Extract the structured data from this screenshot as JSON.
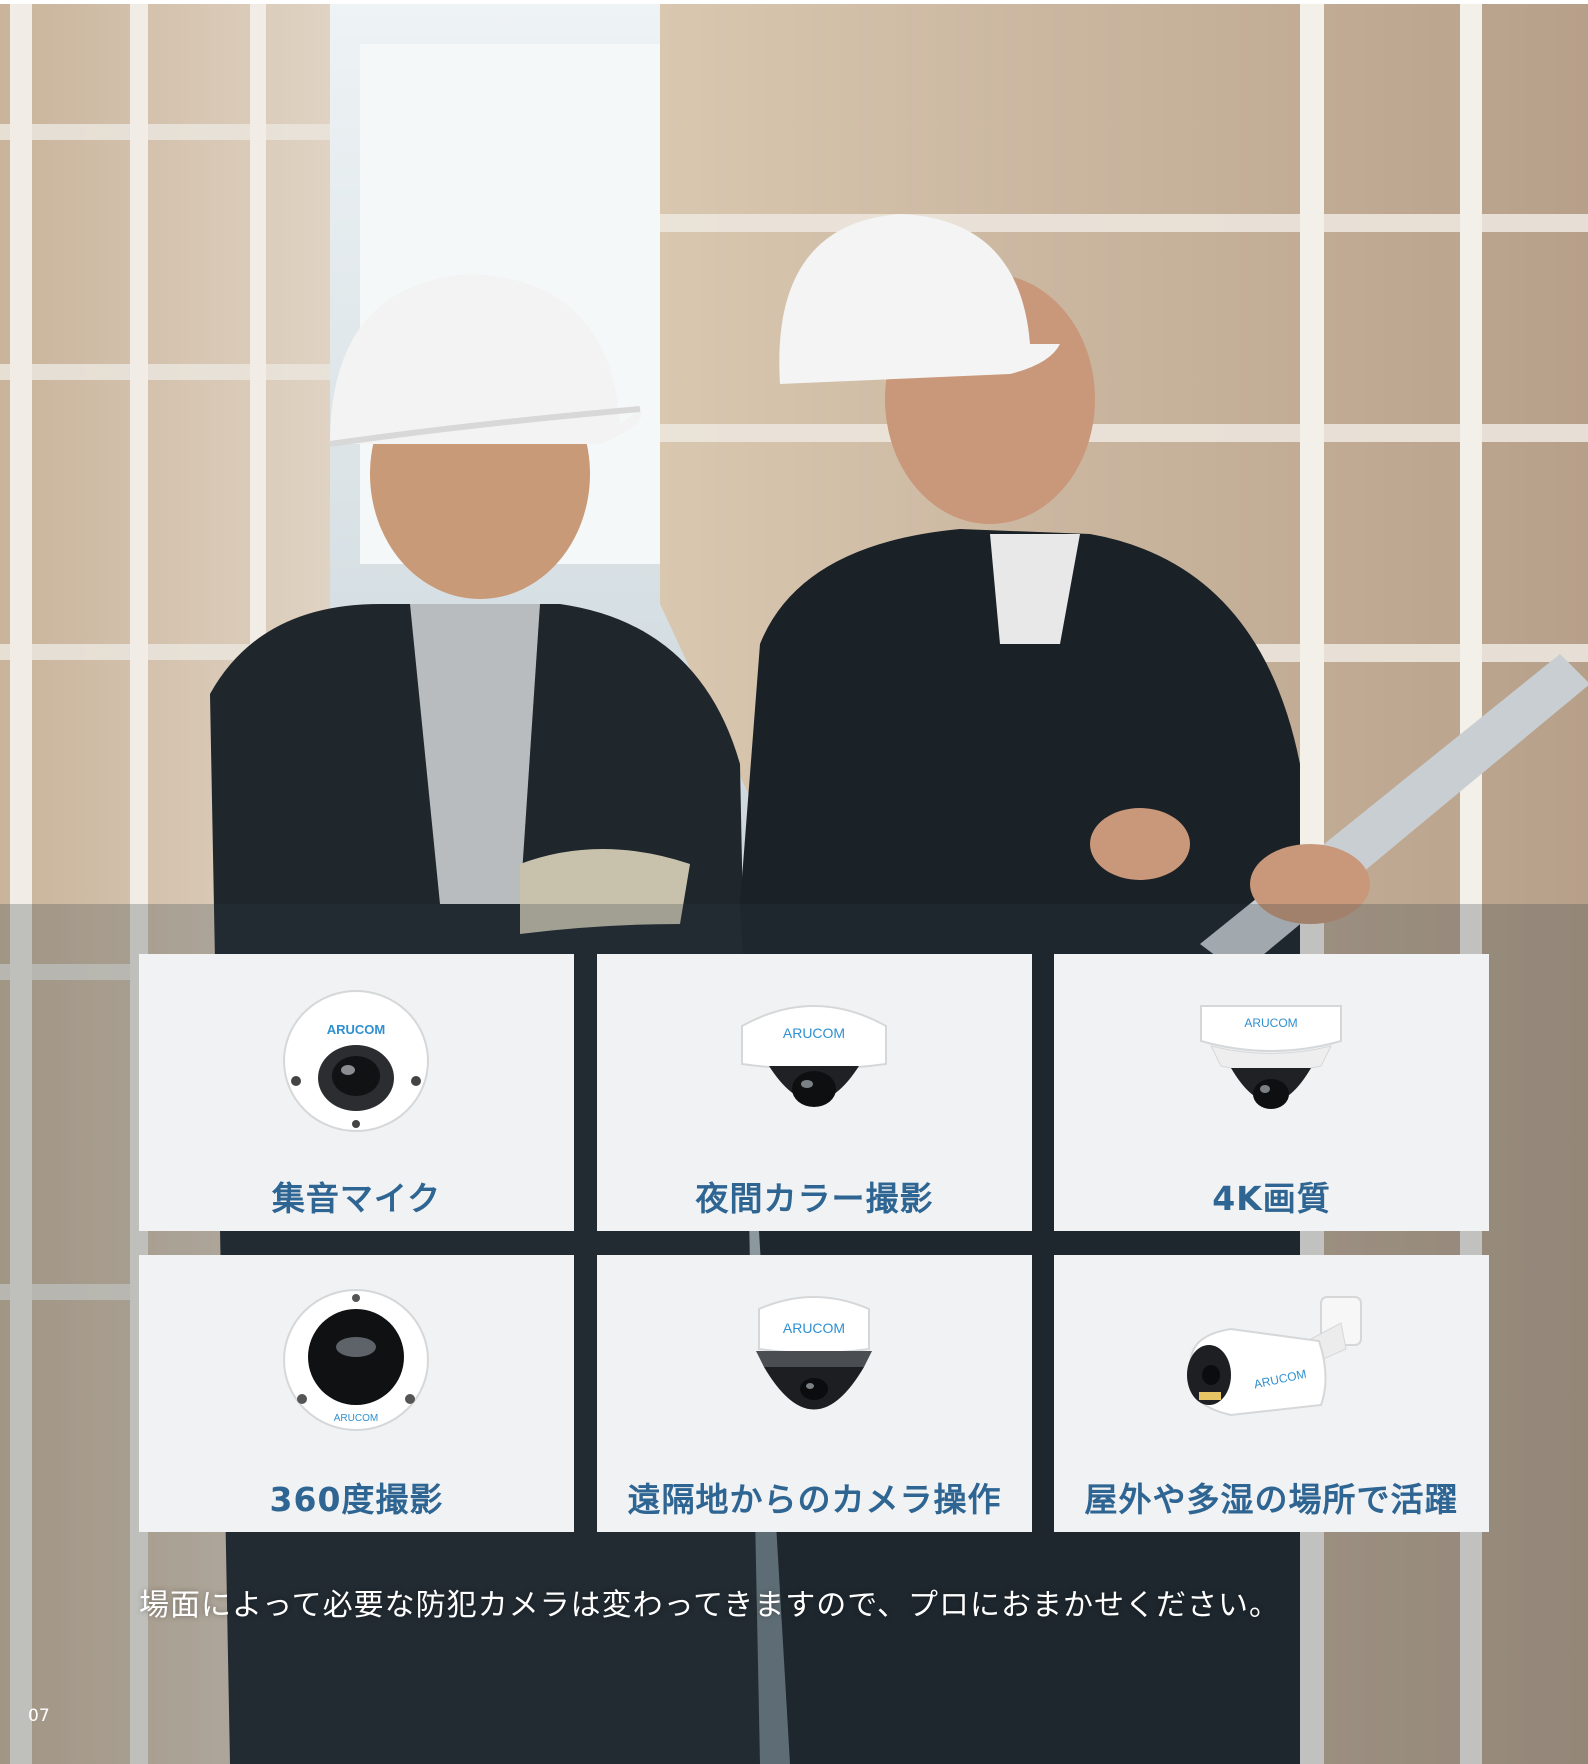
{
  "features": [
    {
      "label": "集音マイク",
      "icon": "mini-dome-camera-icon",
      "brand": "ARUCOM"
    },
    {
      "label": "夜間カラー撮影",
      "icon": "dome-camera-icon",
      "brand": "ARUCOM"
    },
    {
      "label": "4K画質",
      "icon": "vandal-dome-camera-icon",
      "brand": "ARUCOM"
    },
    {
      "label": "360度撮影",
      "icon": "fisheye-camera-icon",
      "brand": "ARUCOM"
    },
    {
      "label": "遠隔地からのカメラ操作",
      "icon": "ptz-camera-icon",
      "brand": "ARUCOM"
    },
    {
      "label": "屋外や多湿の場所で活躍",
      "icon": "bullet-camera-icon",
      "brand": "ARUCOM"
    }
  ],
  "caption": "場面によって必要な防犯カメラは変わってきますので、プロにおまかせください。",
  "page_number": "07",
  "colors": {
    "label": "#2f6592",
    "card_bg": "#f1f2f3",
    "brand": "#2f8fd0"
  }
}
